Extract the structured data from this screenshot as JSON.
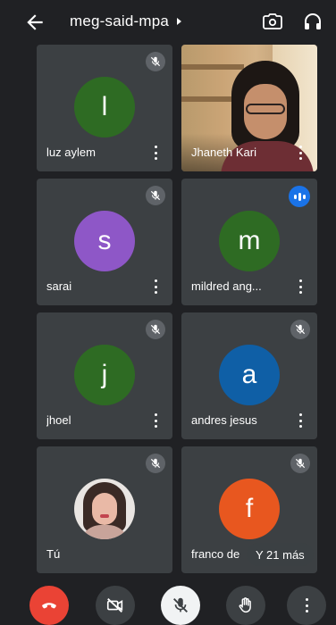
{
  "header": {
    "meeting_code": "meg-said-mpa",
    "icons": [
      "back-arrow-icon",
      "caret-right-icon",
      "switch-camera-icon",
      "headphones-icon"
    ]
  },
  "participants": [
    {
      "name": "luz aylem",
      "initial": "l",
      "color": "#2e6b23",
      "status": "muted"
    },
    {
      "name": "Jhaneth Kari",
      "status": "video"
    },
    {
      "name": "sarai",
      "initial": "s",
      "color": "#8e57c7",
      "status": "muted"
    },
    {
      "name": "mildred ang...",
      "initial": "m",
      "color": "#2e6b23",
      "status": "speaking"
    },
    {
      "name": "jhoel",
      "initial": "j",
      "color": "#2e6b23",
      "status": "muted"
    },
    {
      "name": "andres jesus",
      "initial": "a",
      "color": "#0f5fa6",
      "status": "muted"
    },
    {
      "name": "Tú",
      "status": "self-photo"
    },
    {
      "name": "franco de",
      "initial": "f",
      "color": "#e8571f",
      "status": "muted"
    }
  ],
  "overflow": {
    "label": "Y 21 más"
  },
  "controls": {
    "icons": [
      "end-call-icon",
      "camera-off-icon",
      "mic-off-icon",
      "raise-hand-icon",
      "more-options-icon"
    ]
  },
  "colors": {
    "background": "#202124",
    "tile": "#3c4043",
    "end_call": "#ea4335",
    "speaking": "#1a73e8"
  }
}
